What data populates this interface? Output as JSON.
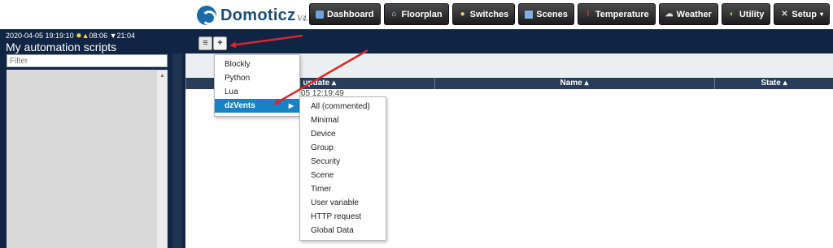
{
  "header": {
    "app_name": "Domoticz",
    "version": "V4.11662",
    "nav": [
      {
        "id": "dashboard",
        "label": "Dashboard",
        "icon": "dashboard-icon"
      },
      {
        "id": "floorplan",
        "label": "Floorplan",
        "icon": "floorplan-icon"
      },
      {
        "id": "switches",
        "label": "Switches",
        "icon": "lightbulb-icon"
      },
      {
        "id": "scenes",
        "label": "Scenes",
        "icon": "scenes-icon"
      },
      {
        "id": "temperature",
        "label": "Temperature",
        "icon": "thermometer-icon"
      },
      {
        "id": "weather",
        "label": "Weather",
        "icon": "cloud-icon"
      },
      {
        "id": "utility",
        "label": "Utility",
        "icon": "utility-icon"
      },
      {
        "id": "setup",
        "label": "Setup",
        "icon": "tools-icon"
      }
    ]
  },
  "sidebar": {
    "datetime": "2020-04-05 19:19:10",
    "sunrise": "08:06",
    "sunset": "21:04",
    "title": "My automation scripts",
    "filter_placeholder": "Filter"
  },
  "table": {
    "columns": [
      "Last update",
      "Name",
      "State"
    ],
    "partial_cell": "05 12:19:49"
  },
  "menu_new": {
    "items": [
      "Blockly",
      "Python",
      "Lua",
      "dzVents"
    ],
    "active": "dzVents"
  },
  "menu_dzvents": {
    "items": [
      "All (commented)",
      "Minimal",
      "Device",
      "Group",
      "Security",
      "Scene",
      "Timer",
      "User variable",
      "HTTP request",
      "Global Data"
    ]
  },
  "colors": {
    "navy": "#102544",
    "header_row": "#283d5a",
    "active_menu": "#1583c6",
    "arrow": "#d9262b"
  }
}
